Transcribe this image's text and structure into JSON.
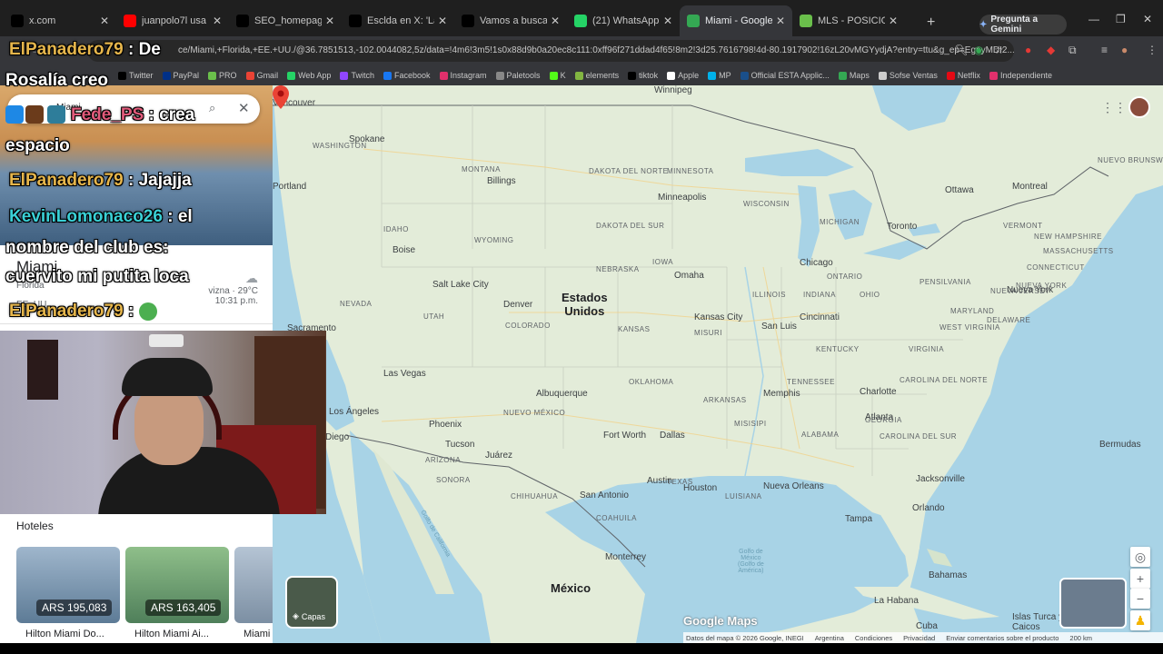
{
  "tabs": [
    {
      "label": "x.com",
      "icon": "x-icon",
      "color": "#000000"
    },
    {
      "label": "juanpolo7l usa - YouT",
      "icon": "youtube-icon",
      "color": "#ff0000"
    },
    {
      "label": "SEO_homepage_title",
      "icon": "tiktok-icon",
      "color": "#000000"
    },
    {
      "label": "Esclda en X: 'La única",
      "icon": "x-icon",
      "color": "#000000"
    },
    {
      "label": "Vamos a buscarlo cor",
      "icon": "tiktok-icon",
      "color": "#000000"
    },
    {
      "label": "(21) WhatsApp",
      "icon": "whatsapp-icon",
      "color": "#25d366"
    },
    {
      "label": "Miami - Google Map",
      "icon": "maps-pin-icon",
      "color": "#34a853",
      "active": true
    },
    {
      "label": "MLS - POSICIONES, F",
      "icon": "soccer-icon",
      "color": "#6abf4b"
    }
  ],
  "gemini_label": "Pregunta a Gemini",
  "url": "ce/Miami,+Florida,+EE.+UU./@36.7851513,-102.0044082,5z/data=!4m6!3m5!1s0x88d9b0a20ec8c111:0xff96f271ddad4f65!8m2!3d25.7616798!4d-80.1917902!16zL20vMGYydjA?entry=ttu&g_ep=EgoyMDI2...",
  "bookmarks": [
    {
      "label": "Twitter",
      "color": "#000000"
    },
    {
      "label": "PayPal",
      "color": "#003087"
    },
    {
      "label": "PRO",
      "color": "#6abf4b"
    },
    {
      "label": "Gmail",
      "color": "#ea4335"
    },
    {
      "label": "Web App",
      "color": "#25d366"
    },
    {
      "label": "Twitch",
      "color": "#9146ff"
    },
    {
      "label": "Facebook",
      "color": "#1877f2"
    },
    {
      "label": "Instagram",
      "color": "#e1306c"
    },
    {
      "label": "Paletools",
      "color": "#888888"
    },
    {
      "label": "K",
      "color": "#53fc18"
    },
    {
      "label": "elements",
      "color": "#82b541"
    },
    {
      "label": "tiktok",
      "color": "#000000"
    },
    {
      "label": "Apple",
      "color": "#ffffff"
    },
    {
      "label": "MP",
      "color": "#00b1ea"
    },
    {
      "label": "Official ESTA Applic...",
      "color": "#1a4f8a"
    },
    {
      "label": "Maps",
      "color": "#34a853"
    },
    {
      "label": "Sofse Ventas",
      "color": "#cccccc"
    },
    {
      "label": "Netflix",
      "color": "#e50914"
    },
    {
      "label": "Independiente",
      "color": "#e1306c"
    }
  ],
  "search": {
    "query": "Miami"
  },
  "place": {
    "title": "Miami",
    "subtitle": "Florida",
    "subtitle2": "EE. UU.",
    "weather_line": "vizna · 29°C",
    "time": "10:31 p.m."
  },
  "hotels_heading": "Hoteles",
  "hotels": [
    {
      "name": "Hilton Miami Do...",
      "price": "ARS 195,083"
    },
    {
      "name": "Hilton Miami Ai...",
      "price": "ARS 163,405"
    },
    {
      "name": "Miami",
      "price": ""
    }
  ],
  "map": {
    "region_labels": [
      {
        "text": "WASHINGTON"
      },
      {
        "text": "MONTANA"
      },
      {
        "text": "DAKOTA DEL NORTE"
      },
      {
        "text": "MINNESOTA"
      },
      {
        "text": "DAKOTA DEL SUR"
      },
      {
        "text": "WISCONSIN"
      },
      {
        "text": "MICHIGAN"
      },
      {
        "text": "IDAHO"
      },
      {
        "text": "WYOMING"
      },
      {
        "text": "NEBRASKA"
      },
      {
        "text": "IOWA"
      },
      {
        "text": "ILLINOIS"
      },
      {
        "text": "INDIANA"
      },
      {
        "text": "OHIO"
      },
      {
        "text": "PENSILVANIA"
      },
      {
        "text": "NEVADA"
      },
      {
        "text": "UTAH"
      },
      {
        "text": "COLORADO"
      },
      {
        "text": "KANSAS"
      },
      {
        "text": "MISURI"
      },
      {
        "text": "KENTUCKY"
      },
      {
        "text": "VIRGINIA"
      },
      {
        "text": "OKLAHOMA"
      },
      {
        "text": "TENNESSEE"
      },
      {
        "text": "CAROLINA DEL NORTE"
      },
      {
        "text": "ARKANSAS"
      },
      {
        "text": "NUEVO MÉXICO"
      },
      {
        "text": "ARIZONA"
      },
      {
        "text": "MISISIPI"
      },
      {
        "text": "ALABAMA"
      },
      {
        "text": "GEORGIA"
      },
      {
        "text": "CAROLINA DEL SUR"
      },
      {
        "text": "TEXAS"
      },
      {
        "text": "LUISIANA"
      },
      {
        "text": "SONORA"
      },
      {
        "text": "CHIHUAHUA"
      },
      {
        "text": "COAHUILA"
      },
      {
        "text": "ONTARIO"
      },
      {
        "text": "NUEVA YORK"
      },
      {
        "text": "NUEVO BRUNSWICK"
      },
      {
        "text": "VERMONT"
      },
      {
        "text": "NEW HAMPSHIRE"
      },
      {
        "text": "MASSACHUSETTS"
      },
      {
        "text": "CONNECTICUT"
      },
      {
        "text": "NUEVA JERSEY"
      },
      {
        "text": "DELAWARE"
      },
      {
        "text": "MARYLAND"
      },
      {
        "text": "WEST VIRGINIA"
      }
    ],
    "cities": [
      {
        "text": "Vancouver"
      },
      {
        "text": "Spokane"
      },
      {
        "text": "Portland"
      },
      {
        "text": "Billings"
      },
      {
        "text": "Boise"
      },
      {
        "text": "Minneapolis"
      },
      {
        "text": "Salt Lake City"
      },
      {
        "text": "Denver"
      },
      {
        "text": "Omaha"
      },
      {
        "text": "Chicago"
      },
      {
        "text": "Toronto"
      },
      {
        "text": "Ottawa"
      },
      {
        "text": "Montreal"
      },
      {
        "text": "Nueva York"
      },
      {
        "text": "Kansas City"
      },
      {
        "text": "San Luis"
      },
      {
        "text": "Cincinnati"
      },
      {
        "text": "Sacramento"
      },
      {
        "text": "Las Vegas"
      },
      {
        "text": "Los Ángeles"
      },
      {
        "text": "Diego"
      },
      {
        "text": "Phoenix"
      },
      {
        "text": "Albuquerque"
      },
      {
        "text": "Tucson"
      },
      {
        "text": "Juárez"
      },
      {
        "text": "Fort Worth"
      },
      {
        "text": "Dallas"
      },
      {
        "text": "Memphis"
      },
      {
        "text": "Charlotte"
      },
      {
        "text": "Atlanta"
      },
      {
        "text": "Austin"
      },
      {
        "text": "Houston"
      },
      {
        "text": "San Antonio"
      },
      {
        "text": "Nueva Orleans"
      },
      {
        "text": "Jacksonville"
      },
      {
        "text": "Orlando"
      },
      {
        "text": "Tampa"
      },
      {
        "text": "Monterrey"
      },
      {
        "text": "Bermudas"
      },
      {
        "text": "Bahamas"
      },
      {
        "text": "La Habana"
      },
      {
        "text": "Cuba"
      },
      {
        "text": "Islas Turca y Caicos"
      },
      {
        "text": "Winnipeg"
      }
    ],
    "country_us": "Estados\nUnidos",
    "country_mx": "México",
    "gulf": "Golfo de\nMéxico\n(Golfo de\nAmérica)",
    "gulf_ca": "Golfo de California",
    "layers_label": "Capas",
    "logo": "Google Maps",
    "footer": [
      "Datos del mapa © 2026 Google, INEGI",
      "Argentina",
      "Condiciones",
      "Privacidad",
      "Enviar comentarios sobre el producto",
      "200 km"
    ]
  },
  "chat": [
    {
      "user": "ElPanadero79",
      "sep": " : ",
      "msg": "De",
      "user_color": "yellow"
    },
    {
      "user": "",
      "sep": "",
      "msg": "Rosalía creo",
      "user_color": "none"
    },
    {
      "user": "Fede_PS",
      "sep": " : ",
      "msg": "crea",
      "user_color": "pink"
    },
    {
      "user": "",
      "sep": "",
      "msg": "espacio",
      "user_color": "none"
    },
    {
      "user": "ElPanadero79",
      "sep": " : ",
      "msg": "Jajajja",
      "user_color": "yellow"
    },
    {
      "user": "KevinLomonaco26",
      "sep": " : ",
      "msg": "el",
      "user_color": "cyan"
    },
    {
      "user": "",
      "sep": "",
      "msg": "nombre del club es:",
      "user_color": "none"
    },
    {
      "user": "",
      "sep": "",
      "msg": "cuervito mi putita loca",
      "user_color": "none"
    },
    {
      "user": "ElPanadero79",
      "sep": " : ",
      "msg": "",
      "user_color": "yellow"
    }
  ]
}
